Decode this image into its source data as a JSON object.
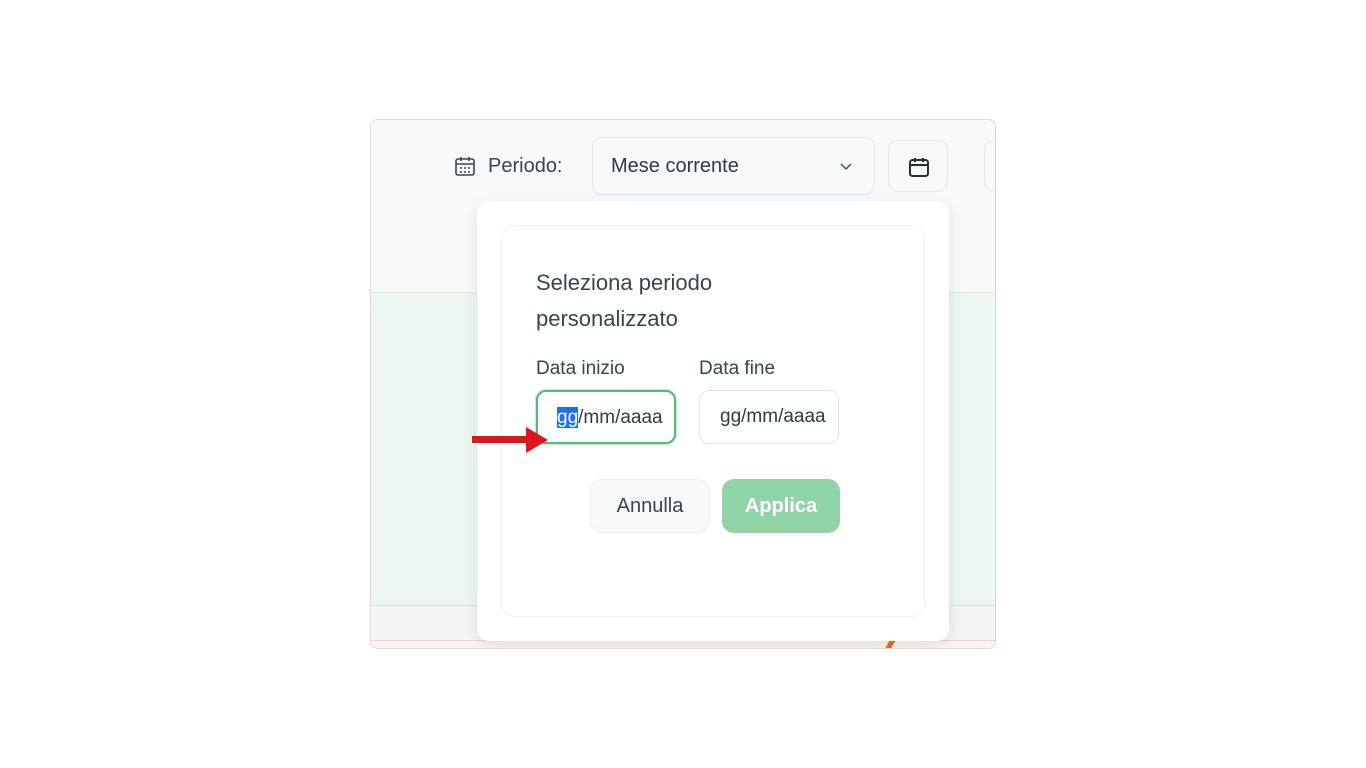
{
  "toolbar": {
    "period_label": "Periodo:",
    "period_select_value": "Mese corrente",
    "icons": [
      "calendar-icon",
      "chevron-down-icon",
      "calendar-icon"
    ]
  },
  "popover": {
    "title": "Seleziona periodo personalizzato",
    "start_label": "Data inizio",
    "end_label": "Data fine",
    "start_value_selected": "gg",
    "start_value_rest": "/mm/aaaa",
    "end_value": "gg/mm/aaaa",
    "cancel_label": "Annulla",
    "apply_label": "Applica"
  },
  "colors": {
    "accent_green": "#55b97a",
    "apply_button": "#8fd3a6",
    "selection_blue": "#1a73e8",
    "annotation_arrow": "#e0141b"
  },
  "annotation": {
    "arrow": "arrow-right-icon"
  }
}
